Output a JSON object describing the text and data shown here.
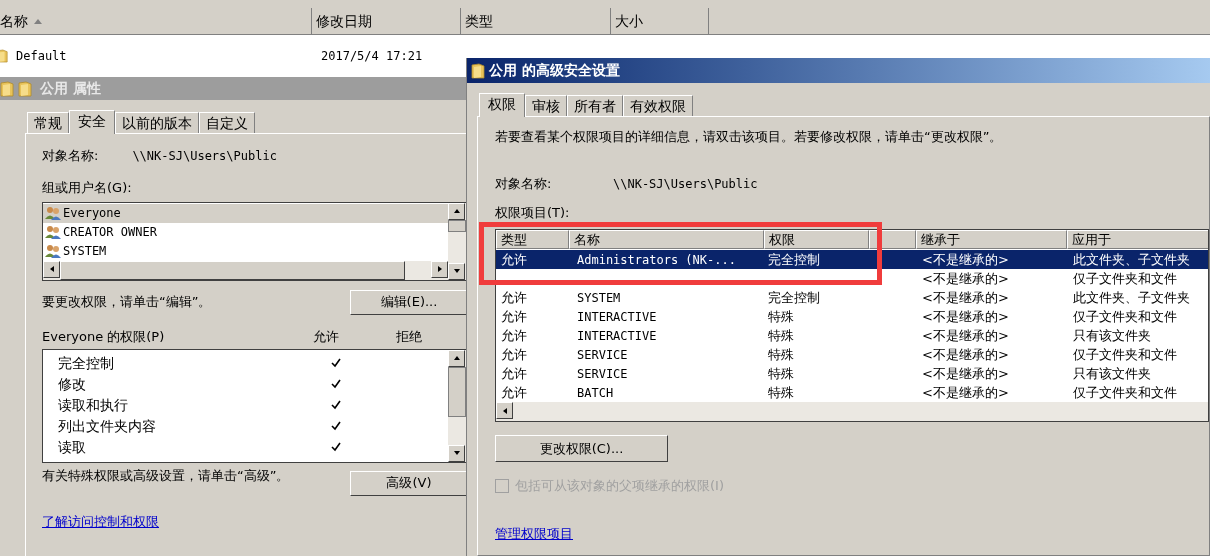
{
  "explorer": {
    "columns": [
      {
        "label": "名称",
        "sorted": true
      },
      {
        "label": "修改日期",
        "sorted": false
      },
      {
        "label": "类型",
        "sorted": false
      },
      {
        "label": "大小",
        "sorted": false
      }
    ],
    "rows": [
      {
        "name": "Default",
        "modified": "2017/5/4 17:21"
      }
    ]
  },
  "properties": {
    "title": "公用 属性",
    "tabs": [
      {
        "label": "常规",
        "selected": false
      },
      {
        "label": "安全",
        "selected": true
      },
      {
        "label": "以前的版本",
        "selected": false
      },
      {
        "label": "自定义",
        "selected": false
      }
    ],
    "object_label": "对象名称:",
    "object_value": "\\\\NK-SJ\\Users\\Public",
    "groups_label": "组或用户名(G):",
    "groups": [
      {
        "name": "Everyone",
        "selected": true
      },
      {
        "name": "CREATOR OWNER",
        "selected": false
      },
      {
        "name": "SYSTEM",
        "selected": false
      }
    ],
    "edit_hint": "要更改权限，请单击“编辑”。",
    "edit_button": "编辑(E)...",
    "permissions_label": "Everyone 的权限(P)",
    "allow_label": "允许",
    "deny_label": "拒绝",
    "permissions": [
      {
        "name": "完全控制",
        "allow": true,
        "deny": false
      },
      {
        "name": "修改",
        "allow": true,
        "deny": false
      },
      {
        "name": "读取和执行",
        "allow": true,
        "deny": false
      },
      {
        "name": "列出文件夹内容",
        "allow": true,
        "deny": false
      },
      {
        "name": "读取",
        "allow": true,
        "deny": false
      }
    ],
    "advanced_hint": "有关特殊权限或高级设置，请单击“高级”。",
    "advanced_button": "高级(V)",
    "link": "了解访问控制和权限"
  },
  "advanced": {
    "title": "公用 的高级安全设置",
    "tabs": [
      {
        "label": "权限",
        "selected": true
      },
      {
        "label": "审核",
        "selected": false
      },
      {
        "label": "所有者",
        "selected": false
      },
      {
        "label": "有效权限",
        "selected": false
      }
    ],
    "info": "若要查看某个权限项目的详细信息，请双击该项目。若要修改权限，请单击“更改权限”。",
    "object_label": "对象名称:",
    "object_value": "\\\\NK-SJ\\Users\\Public",
    "entries_label": "权限项目(T):",
    "columns": [
      "类型",
      "名称",
      "权限",
      "继承于",
      "应用于"
    ],
    "rows": [
      {
        "type": "允许",
        "name": "Administrators (NK-...",
        "permission": "完全控制",
        "inherited_from": "<不是继承的>",
        "applies_to": "此文件夹、子文件夹",
        "selected": true
      },
      {
        "inherited_from": "<不是继承的>",
        "applies_to": "仅子文件夹和文件",
        "selected": false
      },
      {
        "type": "允许",
        "name": "SYSTEM",
        "permission": "完全控制",
        "inherited_from": "<不是继承的>",
        "applies_to": "此文件夹、子文件夹",
        "selected": false
      },
      {
        "type": "允许",
        "name": "INTERACTIVE",
        "permission": "特殊",
        "inherited_from": "<不是继承的>",
        "applies_to": "仅子文件夹和文件",
        "selected": false
      },
      {
        "type": "允许",
        "name": "INTERACTIVE",
        "permission": "特殊",
        "inherited_from": "<不是继承的>",
        "applies_to": "只有该文件夹",
        "selected": false
      },
      {
        "type": "允许",
        "name": "SERVICE",
        "permission": "特殊",
        "inherited_from": "<不是继承的>",
        "applies_to": "仅子文件夹和文件",
        "selected": false
      },
      {
        "type": "允许",
        "name": "SERVICE",
        "permission": "特殊",
        "inherited_from": "<不是继承的>",
        "applies_to": "只有该文件夹",
        "selected": false
      },
      {
        "type": "允许",
        "name": "BATCH",
        "permission": "特殊",
        "inherited_from": "<不是继承的>",
        "applies_to": "仅子文件夹和文件",
        "selected": false
      }
    ],
    "change_button": "更改权限(C)...",
    "inherit_checkbox": {
      "label": "包括可从该对象的父项继承的权限(I)",
      "checked": false,
      "disabled": true
    },
    "link": "管理权限项目"
  }
}
